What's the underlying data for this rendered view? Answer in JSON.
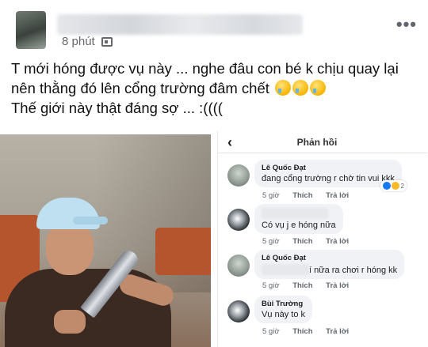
{
  "post": {
    "time": "8 phút",
    "privacy_icon": "group-icon",
    "more_icon": "more-horizontal-icon",
    "lines": [
      "T mới hóng được vụ này ... nghe đâu con bé k chịu quay lại",
      "nên thằng đó lên cổng trường đâm chết",
      "Thế giới này thật đáng sợ ... :(((("
    ],
    "line2_emojis": [
      "crying-face",
      "crying-face",
      "crying-face"
    ]
  },
  "photo": {
    "description_icon": "photo"
  },
  "comments_panel": {
    "title": "Phản hồi",
    "back_icon": "chevron-left-icon",
    "comments": [
      {
        "name": "Lê Quốc Đạt",
        "text": "đang cổng trường r chờ tin vui kkk",
        "time": "5 giờ",
        "like": "Thích",
        "reply": "Trả lời",
        "reactions_count": "2"
      },
      {
        "name": "",
        "text": "Có vụ j e hóng nữa",
        "time": "5 giờ",
        "like": "Thích",
        "reply": "Trả lời"
      },
      {
        "name": "Lê Quốc Đạt",
        "text": "í nữa ra chơi r hóng kk",
        "time": "5 giờ",
        "like": "Thích",
        "reply": "Trả lời"
      },
      {
        "name": "Bùi Trường",
        "text": "Vụ này to k",
        "time": "5 giờ",
        "like": "Thích",
        "reply": "Trả lời"
      }
    ]
  },
  "colors": {
    "meta_gray": "#65676b",
    "bubble_bg": "#f0f2f5",
    "like_blue": "#1877f2"
  }
}
